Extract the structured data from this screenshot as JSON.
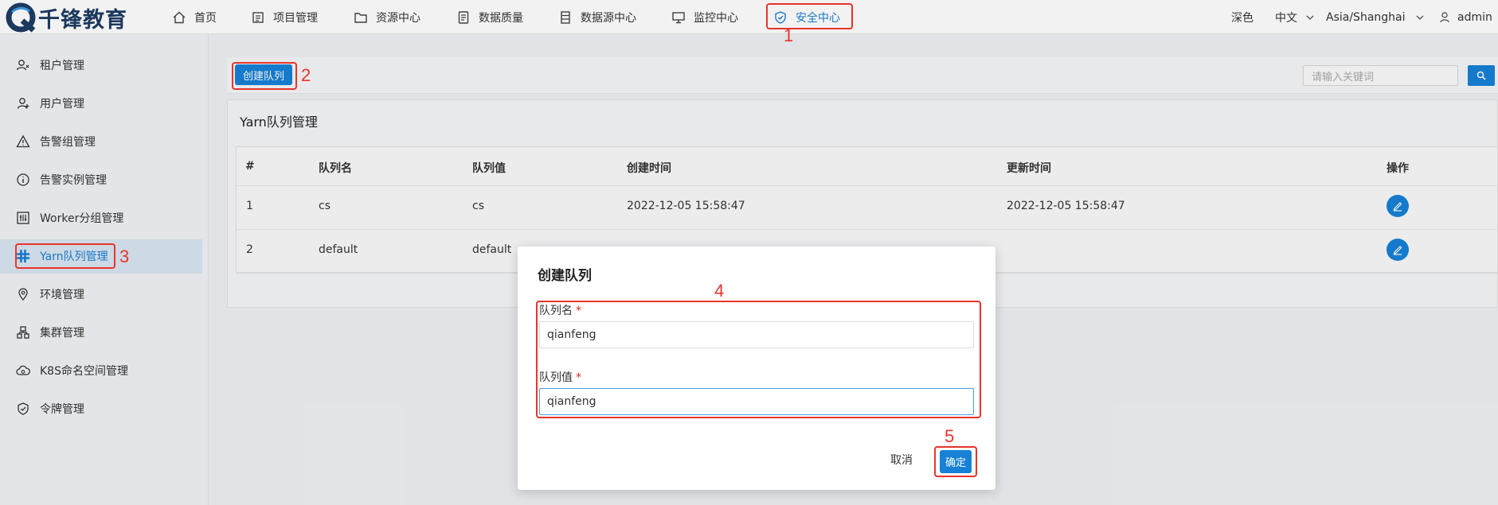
{
  "brand": {
    "name": "千锋教育"
  },
  "nav": {
    "items": [
      {
        "label": "首页",
        "icon": "home-icon"
      },
      {
        "label": "项目管理",
        "icon": "project-icon"
      },
      {
        "label": "资源中心",
        "icon": "folder-icon"
      },
      {
        "label": "数据质量",
        "icon": "data-quality-icon"
      },
      {
        "label": "数据源中心",
        "icon": "datasource-icon"
      },
      {
        "label": "监控中心",
        "icon": "monitor-icon"
      },
      {
        "label": "安全中心",
        "icon": "shield-icon",
        "active": true
      }
    ],
    "theme": "深色",
    "language": "中文",
    "timezone": "Asia/Shanghai",
    "user": "admin"
  },
  "sidebar": {
    "items": [
      {
        "label": "租户管理",
        "icon": "tenant-icon"
      },
      {
        "label": "用户管理",
        "icon": "user-icon"
      },
      {
        "label": "告警组管理",
        "icon": "warning-icon"
      },
      {
        "label": "告警实例管理",
        "icon": "info-icon"
      },
      {
        "label": "Worker分组管理",
        "icon": "worker-icon"
      },
      {
        "label": "Yarn队列管理",
        "icon": "yarn-icon",
        "active": true
      },
      {
        "label": "环境管理",
        "icon": "location-icon"
      },
      {
        "label": "集群管理",
        "icon": "cluster-icon"
      },
      {
        "label": "K8S命名空间管理",
        "icon": "cloud-icon"
      },
      {
        "label": "令牌管理",
        "icon": "token-icon"
      }
    ]
  },
  "toolbar": {
    "create_label": "创建队列",
    "search_placeholder": "请输入关键词"
  },
  "card": {
    "title": "Yarn队列管理"
  },
  "table": {
    "headers": [
      "#",
      "队列名",
      "队列值",
      "创建时间",
      "更新时间",
      "操作"
    ],
    "rows": [
      {
        "index": "1",
        "name": "cs",
        "value": "cs",
        "created": "2022-12-05 15:58:47",
        "updated": "2022-12-05 15:58:47"
      },
      {
        "index": "2",
        "name": "default",
        "value": "default",
        "created": "",
        "updated": ""
      }
    ]
  },
  "dialog": {
    "title": "创建队列",
    "name_label": "队列名",
    "name_value": "qianfeng",
    "value_label": "队列值",
    "value_value": "qianfeng",
    "required_mark": "*",
    "cancel_label": "取消",
    "ok_label": "确定"
  },
  "annotations": [
    "1",
    "2",
    "3",
    "4",
    "5"
  ],
  "colors": {
    "primary": "#1781d6",
    "annotation": "#e8342b",
    "active_nav": "#1b7fd3"
  }
}
